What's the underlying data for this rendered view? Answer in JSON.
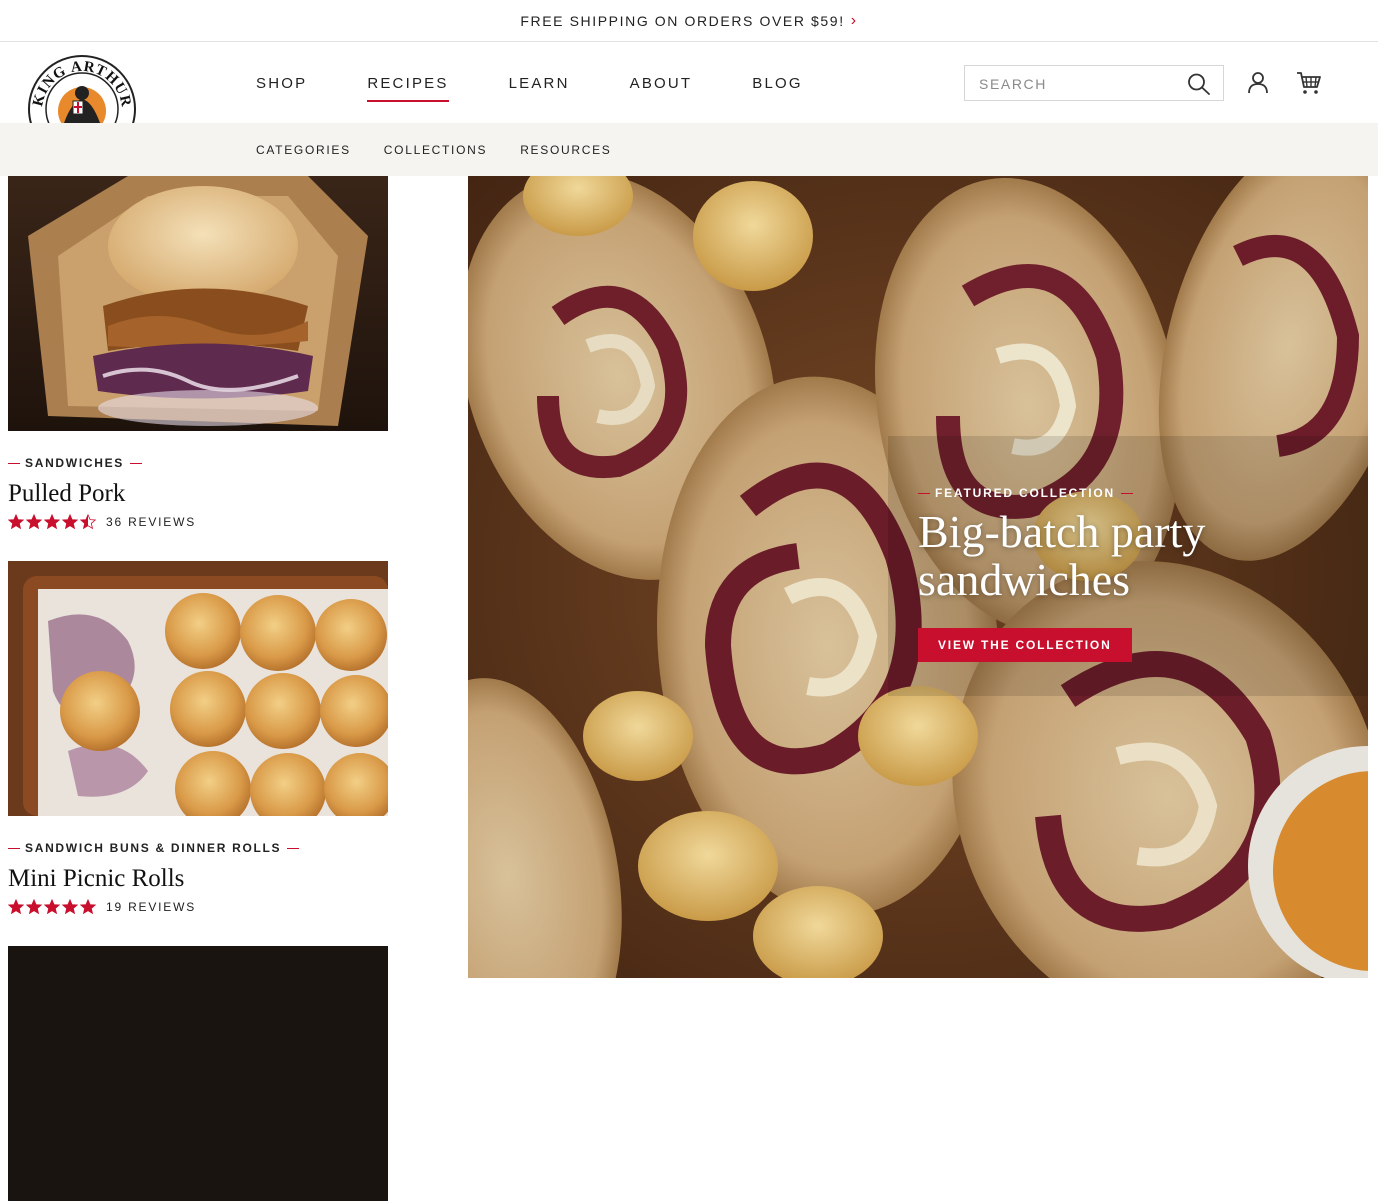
{
  "promo": {
    "text": "FREE SHIPPING ON ORDERS OVER $59!"
  },
  "header": {
    "logo_text": "KING ARTHUR FLOUR",
    "nav": [
      {
        "label": "SHOP"
      },
      {
        "label": "RECIPES",
        "active": true
      },
      {
        "label": "LEARN"
      },
      {
        "label": "ABOUT"
      },
      {
        "label": "BLOG"
      }
    ],
    "search_placeholder": "SEARCH"
  },
  "subnav": [
    {
      "label": "CATEGORIES"
    },
    {
      "label": "COLLECTIONS"
    },
    {
      "label": "RESOURCES"
    }
  ],
  "cards": [
    {
      "category": "SANDWICHES",
      "title": "Pulled Pork",
      "rating": 4.5,
      "reviews": "36 REVIEWS"
    },
    {
      "category": "SANDWICH BUNS & DINNER ROLLS",
      "title": "Mini Picnic Rolls",
      "rating": 5,
      "reviews": "19 REVIEWS"
    }
  ],
  "hero": {
    "eyebrow": "FEATURED COLLECTION",
    "title_line1": "Big-batch party",
    "title_line2": "sandwiches",
    "button": "VIEW THE COLLECTION"
  },
  "colors": {
    "accent": "#c8102e",
    "subnav_bg": "#f6f4f0"
  }
}
